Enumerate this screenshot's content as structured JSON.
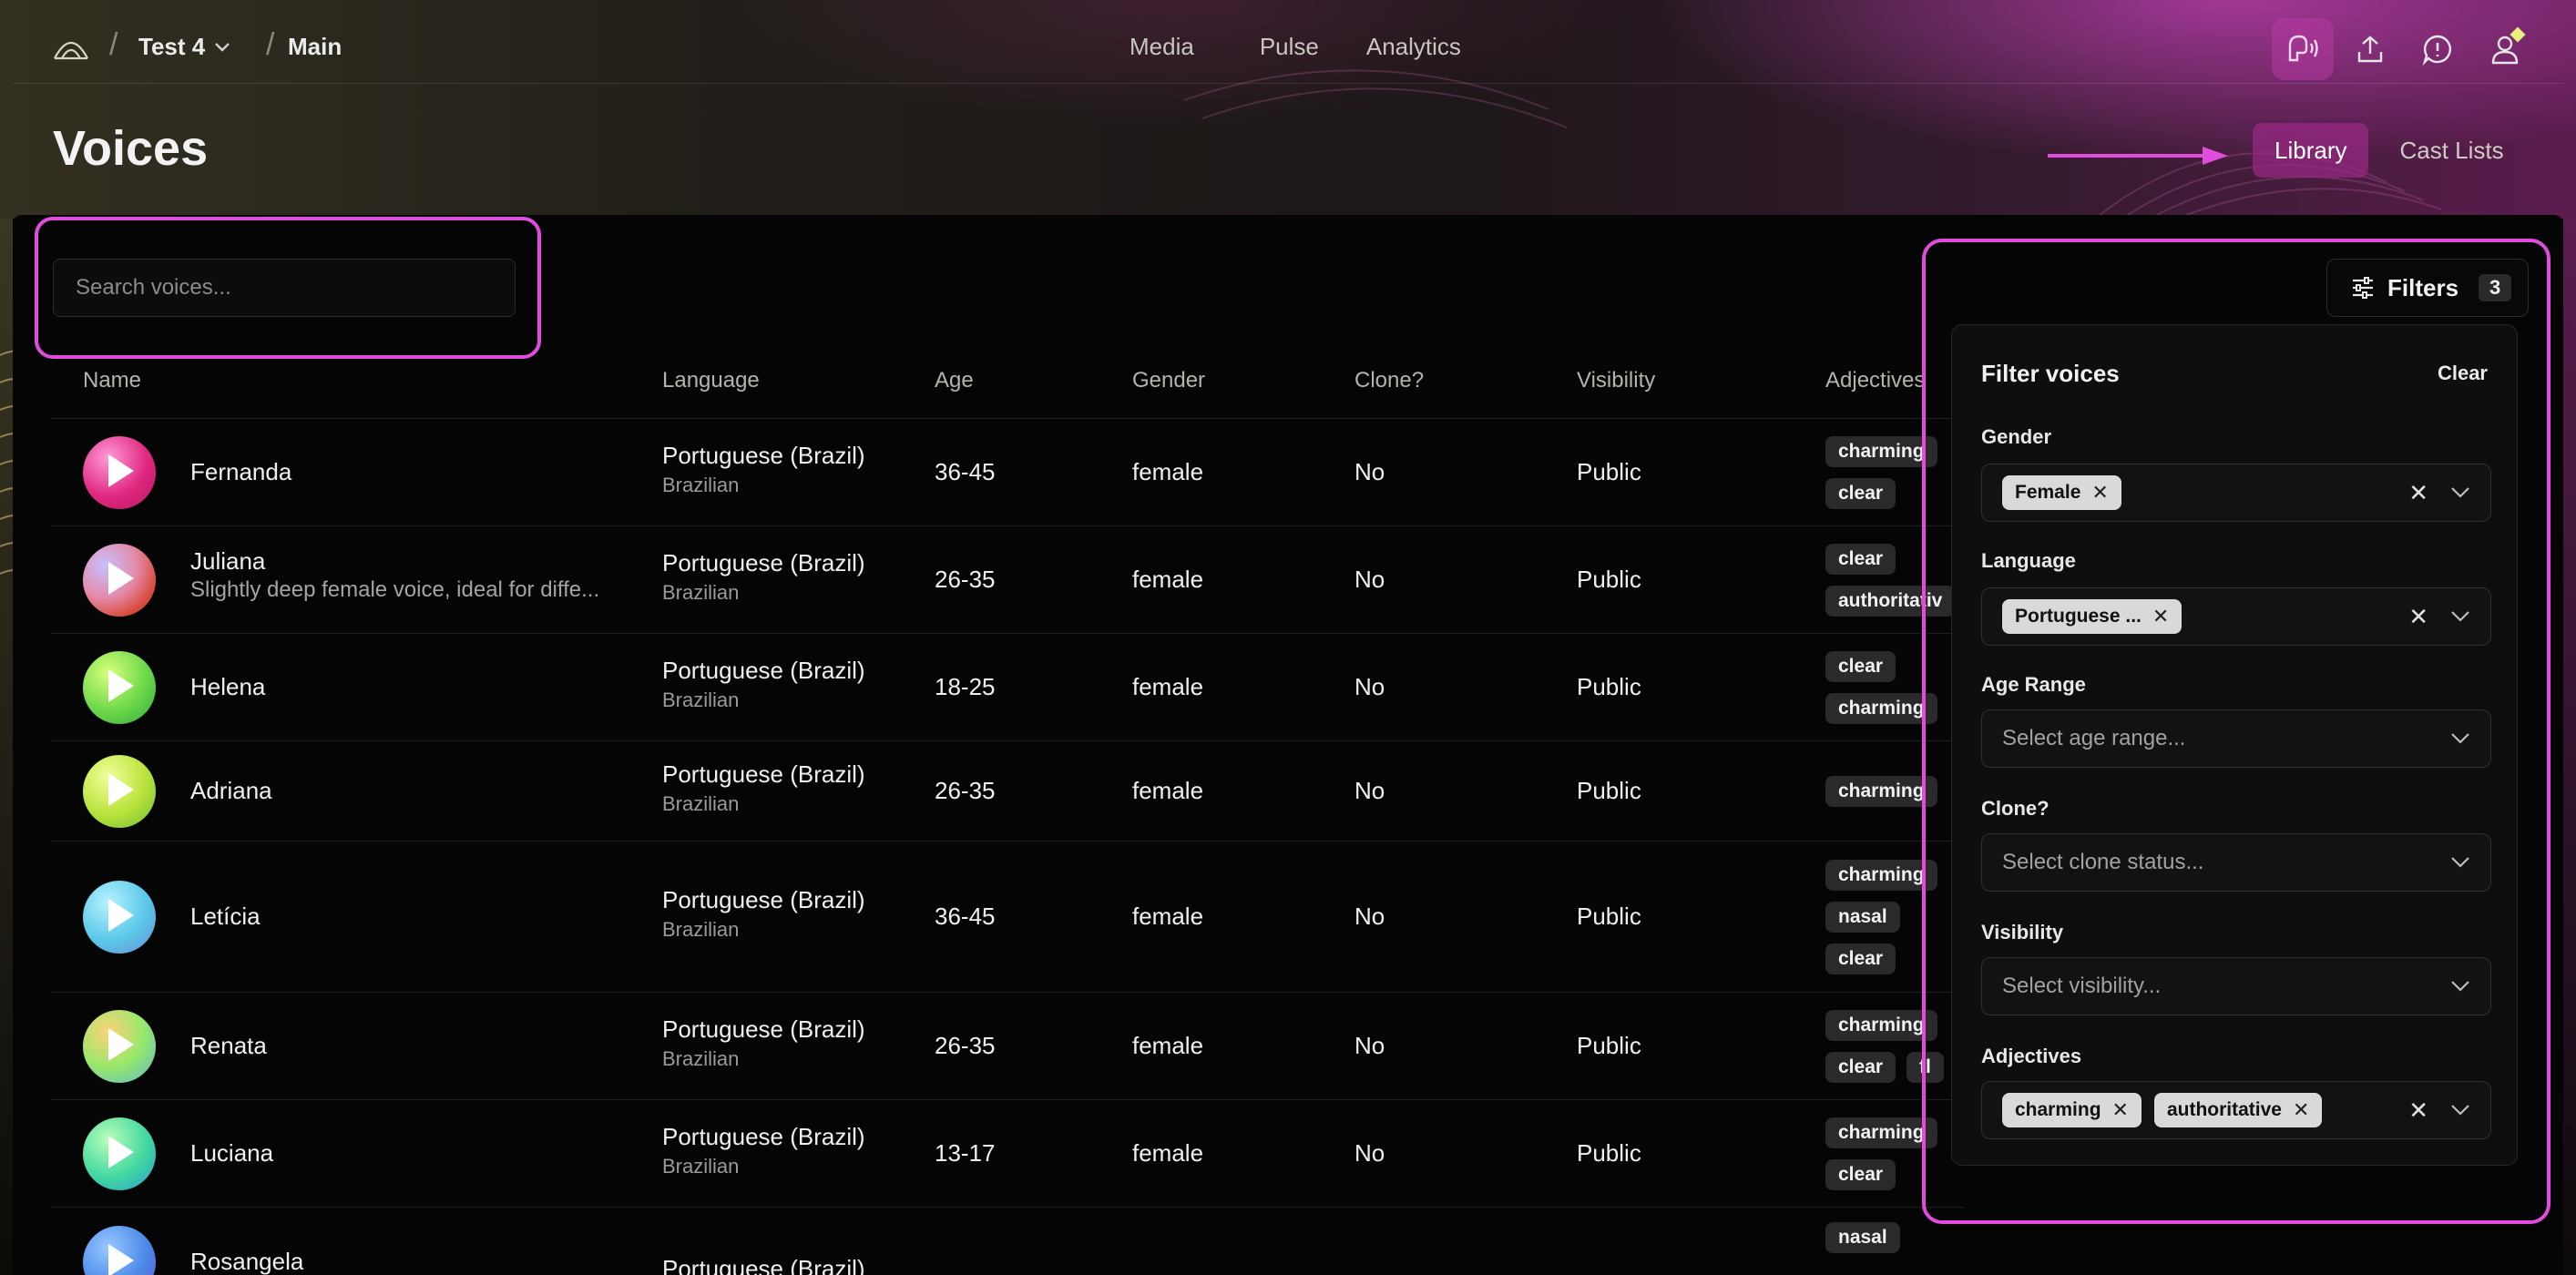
{
  "breadcrumb": {
    "project": "Test 4",
    "page": "Main"
  },
  "nav": {
    "links": [
      "Media",
      "Pulse",
      "Analytics"
    ]
  },
  "page": {
    "title": "Voices"
  },
  "tabs": {
    "library": "Library",
    "cast_lists": "Cast Lists"
  },
  "search": {
    "placeholder": "Search voices..."
  },
  "table": {
    "headers": {
      "name": "Name",
      "language": "Language",
      "age": "Age",
      "gender": "Gender",
      "clone": "Clone?",
      "visibility": "Visibility",
      "adjectives": "Adjectives"
    },
    "rows": [
      {
        "name": "Fernanda",
        "description": "",
        "language": "Portuguese (Brazil)",
        "accent": "Brazilian",
        "age": "36-45",
        "gender": "female",
        "clone": "No",
        "visibility": "Public",
        "tags": [
          [
            "charming"
          ],
          [
            "clear"
          ]
        ]
      },
      {
        "name": "Juliana",
        "description": "Slightly deep female voice, ideal for diffe...",
        "language": "Portuguese (Brazil)",
        "accent": "Brazilian",
        "age": "26-35",
        "gender": "female",
        "clone": "No",
        "visibility": "Public",
        "tags": [
          [
            "clear"
          ],
          [
            "authoritativ"
          ]
        ]
      },
      {
        "name": "Helena",
        "description": "",
        "language": "Portuguese (Brazil)",
        "accent": "Brazilian",
        "age": "18-25",
        "gender": "female",
        "clone": "No",
        "visibility": "Public",
        "tags": [
          [
            "clear"
          ],
          [
            "charming"
          ]
        ]
      },
      {
        "name": "Adriana",
        "description": "",
        "language": "Portuguese (Brazil)",
        "accent": "Brazilian",
        "age": "26-35",
        "gender": "female",
        "clone": "No",
        "visibility": "Public",
        "tags": [
          [
            "charming"
          ]
        ]
      },
      {
        "name": "Letícia",
        "description": "",
        "language": "Portuguese (Brazil)",
        "accent": "Brazilian",
        "age": "36-45",
        "gender": "female",
        "clone": "No",
        "visibility": "Public",
        "tags": [
          [
            "charming"
          ],
          [
            "nasal"
          ],
          [
            "clear"
          ]
        ]
      },
      {
        "name": "Renata",
        "description": "",
        "language": "Portuguese (Brazil)",
        "accent": "Brazilian",
        "age": "26-35",
        "gender": "female",
        "clone": "No",
        "visibility": "Public",
        "tags": [
          [
            "charming"
          ],
          [
            "clear",
            "fl"
          ]
        ]
      },
      {
        "name": "Luciana",
        "description": "",
        "language": "Portuguese (Brazil)",
        "accent": "Brazilian",
        "age": "13-17",
        "gender": "female",
        "clone": "No",
        "visibility": "Public",
        "tags": [
          [
            "charming"
          ],
          [
            "clear"
          ]
        ]
      },
      {
        "name": "Rosangela",
        "description": "",
        "language": "Portuguese (Brazil)",
        "accent": "",
        "age": "",
        "gender": "",
        "clone": "",
        "visibility": "",
        "tags": [
          [
            "nasal"
          ]
        ]
      }
    ]
  },
  "filters": {
    "button_label": "Filters",
    "count": "3",
    "panel_title": "Filter voices",
    "clear_label": "Clear",
    "gender": {
      "label": "Gender",
      "chips": [
        "Female"
      ]
    },
    "language": {
      "label": "Language",
      "chips": [
        "Portuguese ..."
      ]
    },
    "age_range": {
      "label": "Age Range",
      "placeholder": "Select age range..."
    },
    "clone": {
      "label": "Clone?",
      "placeholder": "Select clone status..."
    },
    "visibility": {
      "label": "Visibility",
      "placeholder": "Select visibility..."
    },
    "adjectives": {
      "label": "Adjectives",
      "chips": [
        "charming",
        "authoritative"
      ]
    }
  },
  "colors": {
    "accent": "#e04ddc",
    "active_tab": "#96288a",
    "tag_bg": "#2a2a2a",
    "chip_bg": "#d9d9d9"
  },
  "icons": {
    "logo": "brand-logo-icon",
    "nav": [
      "voice-library-icon",
      "upload-icon",
      "feedback-icon",
      "user-icon"
    ],
    "filters": "sliders-icon"
  }
}
